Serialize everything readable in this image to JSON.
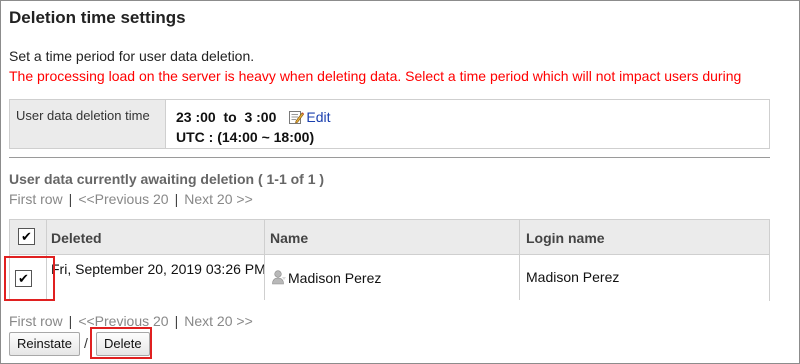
{
  "page": {
    "title": "Deletion time settings",
    "description": "Set a time period for user data deletion.",
    "warning": "The processing load on the server is heavy when deleting data. Select a time period which will not impact users during"
  },
  "settings": {
    "label": "User data deletion time",
    "time_range": "23 :00  to  3 :00",
    "edit_label": "Edit",
    "utc": "UTC : (14:00 ~ 18:00)"
  },
  "awaiting": {
    "title": "User data currently awaiting deletion ( 1-1 of 1 )"
  },
  "pager": {
    "first": "First row",
    "separator": "|",
    "previous": "<<Previous 20",
    "next": "Next 20 >>"
  },
  "table": {
    "headers": {
      "deleted": "Deleted",
      "name": "Name",
      "login": "Login name"
    },
    "rows": [
      {
        "checked": true,
        "deleted": "Fri, September 20, 2019 03:26 PM",
        "name": "Madison Perez",
        "login": "Madison Perez"
      }
    ]
  },
  "buttons": {
    "reinstate": "Reinstate",
    "separator": "/",
    "delete": "Delete"
  },
  "colors": {
    "warning": "#ff0000",
    "highlight": "#e02020",
    "link": "#1a3fae"
  },
  "icons": {
    "edit": "edit-icon",
    "user": "user-icon",
    "check": "checkmark-icon"
  }
}
